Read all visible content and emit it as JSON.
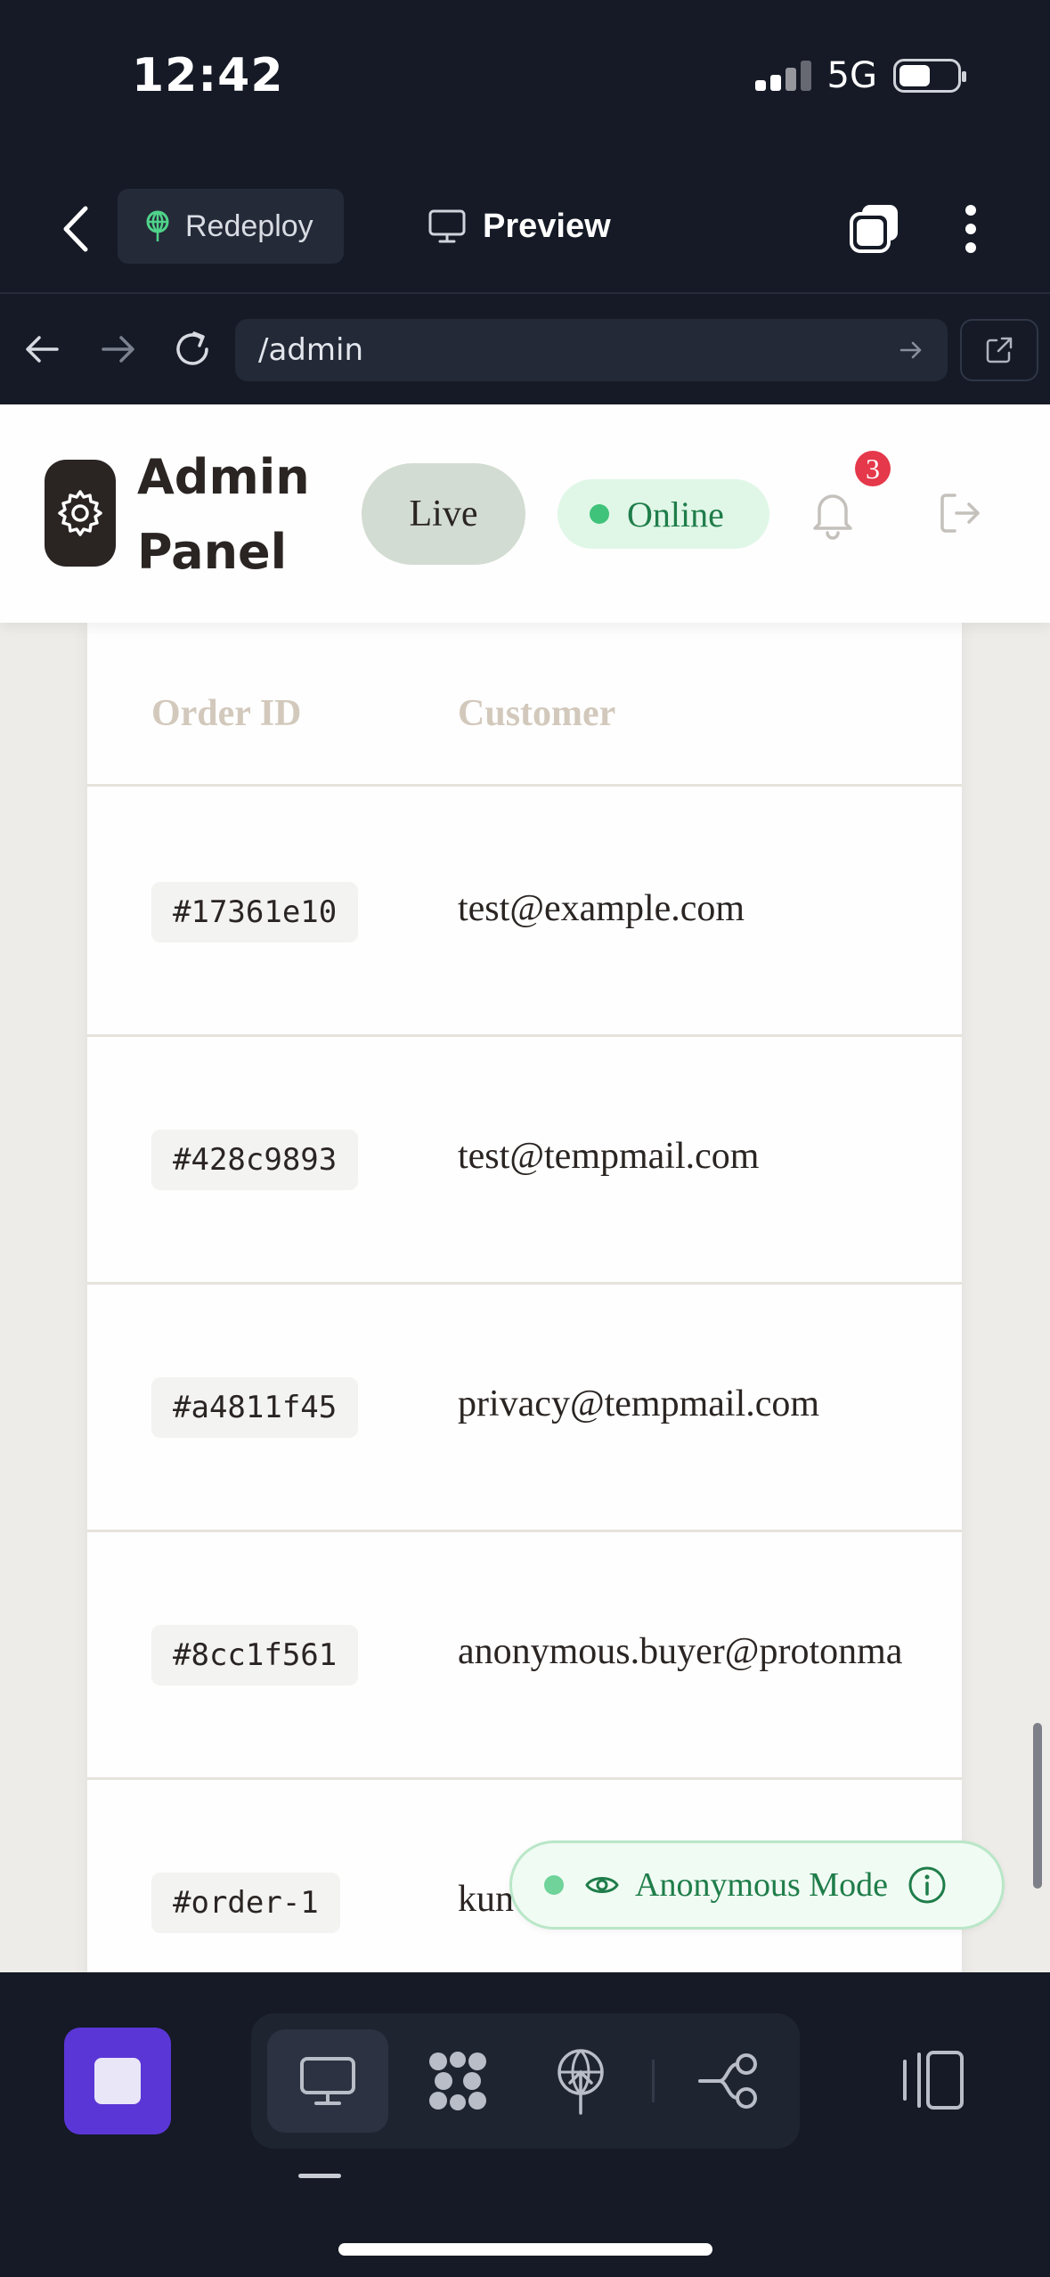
{
  "status_bar": {
    "time": "12:42",
    "network": "5G"
  },
  "toolbar": {
    "redeploy_label": "Redeploy",
    "preview_label": "Preview"
  },
  "browser": {
    "url": "/admin"
  },
  "admin_header": {
    "brand_line1": "Admin",
    "brand_line2": "Panel",
    "live_label": "Live",
    "online_label": "Online",
    "notification_count": "3"
  },
  "orders_table": {
    "columns": [
      "Order ID",
      "Customer"
    ],
    "rows": [
      {
        "order_id": "#17361e10",
        "customer": "test@example.com"
      },
      {
        "order_id": "#428c9893",
        "customer": "test@tempmail.com"
      },
      {
        "order_id": "#a4811f45",
        "customer": "privacy@tempmail.com"
      },
      {
        "order_id": "#8cc1f561",
        "customer": "anonymous.buyer@protonma"
      },
      {
        "order_id": "#order-1",
        "customer": "kun"
      }
    ]
  },
  "anonymous_mode": {
    "label": "Anonymous Mode"
  },
  "colors": {
    "app_bg": "#151a26",
    "accent_purple": "#5a36d6",
    "online_green": "#3fc37a",
    "badge_red": "#e5384a"
  },
  "icons": {
    "toolbar": [
      "chevron-left-icon",
      "antenna-icon",
      "monitor-icon",
      "tabs-icon",
      "more-vertical-icon"
    ],
    "browser": [
      "arrow-left-icon",
      "arrow-right-icon",
      "reload-icon",
      "arrow-right-small-icon",
      "external-link-icon"
    ],
    "header": [
      "gear-icon",
      "bell-icon",
      "logout-icon"
    ],
    "bottom_bar": [
      "stop-icon",
      "monitor-icon",
      "dots-grid-icon",
      "antenna-icon",
      "branch-icon",
      "panel-toggle-icon"
    ]
  }
}
